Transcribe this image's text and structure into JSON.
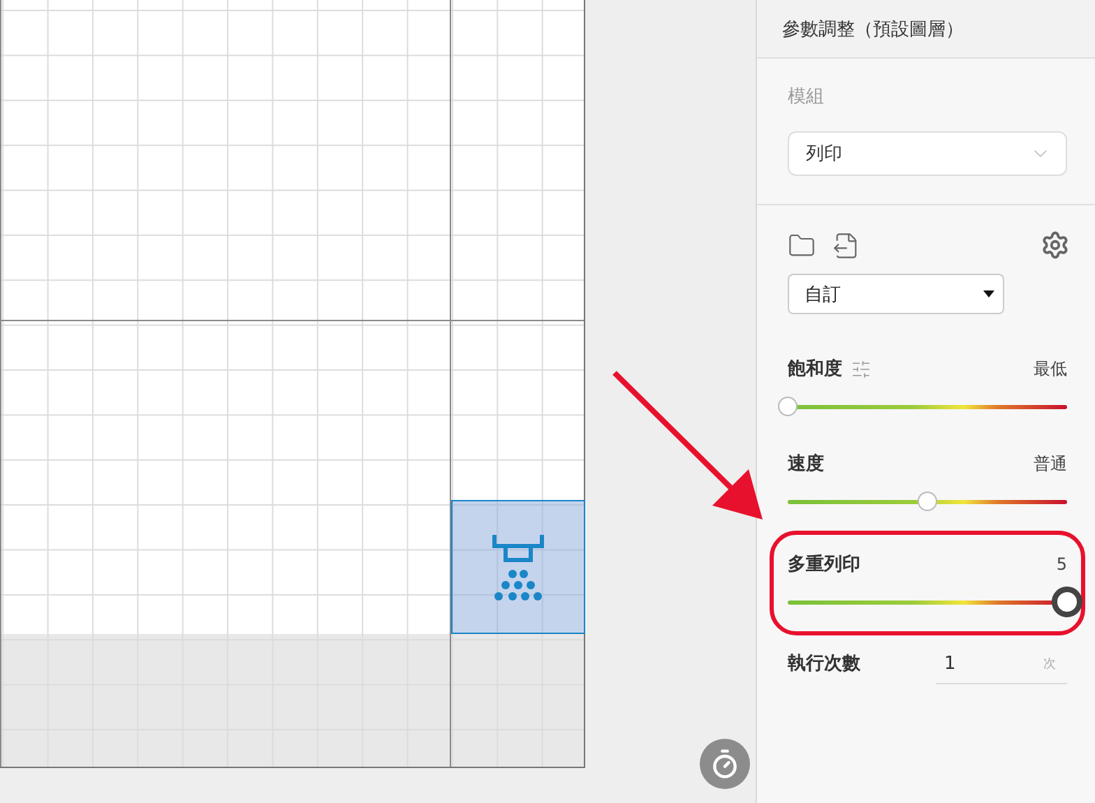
{
  "panel": {
    "title": "參數調整（預設圖層）"
  },
  "module": {
    "label": "模組",
    "value": "列印"
  },
  "preset": {
    "value": "自訂"
  },
  "sliders": [
    {
      "label": "飽和度",
      "reading": "最低",
      "level": 0,
      "tune_icon": true,
      "focused": false,
      "highlighted": false
    },
    {
      "label": "速度",
      "reading": "普通",
      "level": 0.5,
      "tune_icon": false,
      "focused": false,
      "highlighted": false
    },
    {
      "label": "多重列印",
      "reading": "5",
      "level": 1,
      "tune_icon": false,
      "focused": true,
      "highlighted": true
    }
  ],
  "run_count": {
    "label": "執行次數",
    "value": "1",
    "unit": "次"
  },
  "canvas": {
    "selected_tile": true
  }
}
